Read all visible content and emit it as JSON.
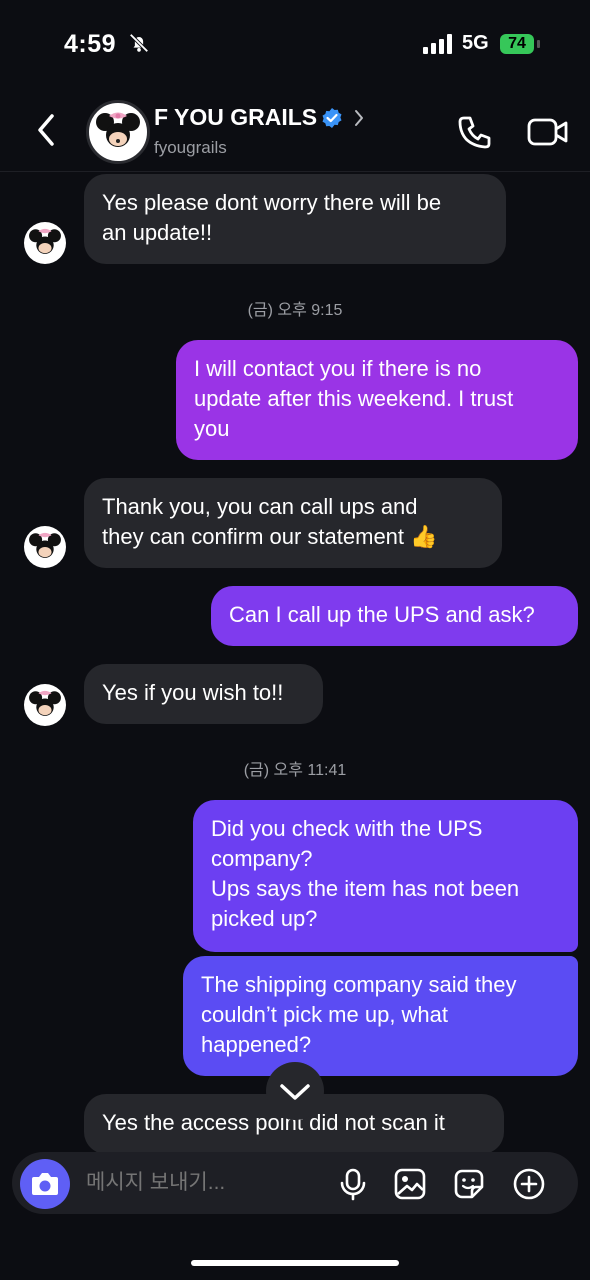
{
  "status_bar": {
    "time": "4:59",
    "network": "5G",
    "battery": "74"
  },
  "header": {
    "title": "F YOU GRAILS",
    "handle": "fyougrails"
  },
  "messages": [
    {
      "side": "in",
      "text1": "Yes please dont worry there will be",
      "text2": "an update!!"
    },
    {
      "type": "timestamp",
      "text": "(금) 오후 9:15"
    },
    {
      "side": "out",
      "text1": "I will contact you if there is no",
      "text2": "update after this weekend. I trust",
      "text3": "you"
    },
    {
      "side": "in",
      "text1": "Thank you, you can call ups and",
      "text2": "they can confirm our statement 👍"
    },
    {
      "side": "out",
      "text1": "Can I call up the UPS and ask?"
    },
    {
      "side": "in",
      "text1": "Yes if you wish to!!"
    },
    {
      "type": "timestamp",
      "text": "(금) 오후 11:41"
    },
    {
      "side": "out",
      "text1": "Did you check with the UPS",
      "text2": "company?",
      "text3": "Ups says the item has not been",
      "text4": "picked up?"
    },
    {
      "side": "out",
      "text1": "The shipping company said they",
      "text2": "couldn’t pick me up, what",
      "text3": "happened?"
    },
    {
      "side": "in",
      "text1": "Yes the access point did not scan it"
    }
  ],
  "composer": {
    "placeholder": "메시지 보내기..."
  },
  "colors": {
    "bubble_out_top": "#9a34e6",
    "bubble_out_mid": "#7a3cf0",
    "bubble_out_bottom": "#5b4cf3",
    "bubble_in": "#26272c",
    "verified": "#3a93f7",
    "camera": "#5f5ff5"
  },
  "icons": [
    "bell-off-icon",
    "signal-icon",
    "back-chevron-icon",
    "verified-icon",
    "chevron-right-icon",
    "phone-icon",
    "video-icon",
    "chevron-down-icon",
    "camera-icon",
    "mic-icon",
    "image-icon",
    "sticker-icon",
    "plus-icon",
    "avatar-minnie-icon"
  ]
}
